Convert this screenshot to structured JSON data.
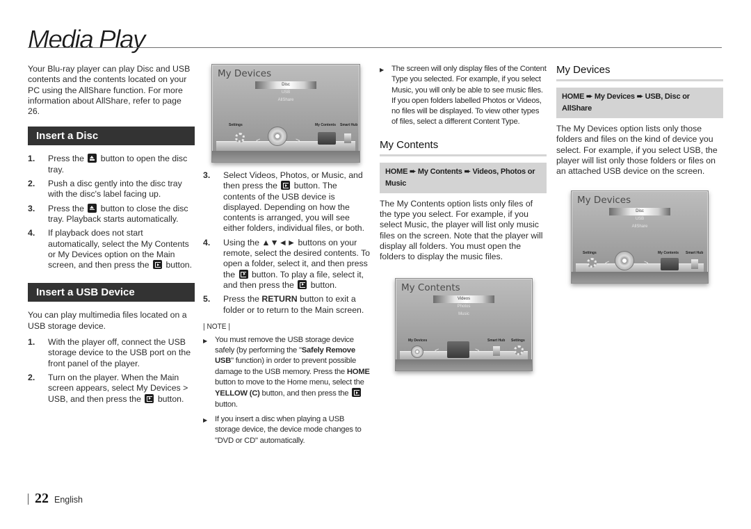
{
  "page": {
    "title": "Media Play",
    "page_number": "22",
    "language": "English"
  },
  "intro": "Your Blu-ray player can play Disc and USB contents and the contents located on your PC using the AllShare function. For more information about AllShare, refer to page 26.",
  "insert_disc": {
    "heading": "Insert a Disc",
    "steps": [
      {
        "num": "1.",
        "before": "Press the",
        "icon": "eject-icon",
        "after": "button to open the disc tray."
      },
      {
        "num": "2.",
        "before": "Push a disc gently into the disc tray with the disc's label facing up.",
        "icon": "",
        "after": ""
      },
      {
        "num": "3.",
        "before": "Press the",
        "icon": "eject-icon",
        "after": "button to close the disc tray. Playback starts automatically."
      },
      {
        "num": "4.",
        "before": "If playback does not start automatically, select the My Contents or My Devices option on the Main screen, and then press the",
        "icon": "enter-icon",
        "after": "button."
      }
    ]
  },
  "insert_usb": {
    "heading": "Insert a USB Device",
    "intro": "You can play multimedia files located on a USB storage device.",
    "steps": [
      {
        "num": "1.",
        "text": "With the player off, connect the USB storage device to the USB port on the front panel of the player."
      },
      {
        "num": "2.",
        "before": "Turn on the player. When the Main screen appears, select My Devices > USB, and then press the",
        "icon": "enter-icon",
        "after": "button."
      },
      {
        "num": "3.",
        "a": "Select Videos, Photos, or Music, and then press the",
        "b": "button. The contents of the USB device is displayed. Depending on how the contents is arranged, you will see either folders, individual files, or both."
      },
      {
        "num": "4.",
        "a": "Using the ▲▼◄► buttons on your remote, select the desired contents. To open a folder, select it, and then press the",
        "b": "button. To play a file, select it, and then press the",
        "c": "button."
      },
      {
        "num": "5.",
        "a": "Press the",
        "bold": "RETURN",
        "b": "button to exit a folder or to return to the Main screen."
      }
    ]
  },
  "note": {
    "heading": "| NOTE |",
    "bullets": [
      {
        "a": "You must remove the USB storage device safely (by performing the \"",
        "b1": "Safely Remove USB",
        "c": "\" function) in order to prevent possible damage to the USB memory. Press the",
        "b2": "HOME",
        "d": "button to move to the Home menu, select the",
        "b3": "YELLOW (C)",
        "e": "button, and then press the",
        "f": "button."
      },
      {
        "a": "If you insert a disc when playing a USB storage device, the device mode changes to \"DVD or CD\" automatically."
      },
      {
        "a": "The screen will only display files of the Content Type you selected. For example, if you select Music, you will only be able to see music files. If you open folders labelled Photos or Videos, no files will be displayed. To view other types of files, select a different Content Type."
      }
    ]
  },
  "my_contents": {
    "heading": "My Contents",
    "path": "HOME ➨ My Contents ➨ Videos, Photos or Music",
    "body": "The My Contents option lists only files of the type you select. For example, if you select Music, the player will list only music files on the screen. Note that the player will display all folders. You must open the folders to display the music files."
  },
  "my_devices": {
    "heading": "My Devices",
    "path": "HOME ➨ My Devices ➨ USB, Disc or AllShare",
    "body": "The My Devices option lists only those folders and files on the kind of device you select. For example, if you select USB, the player will list only those folders or files on an attached USB device on the screen."
  },
  "screens": {
    "devices": {
      "title": "My Devices",
      "menu": [
        "Disc",
        "USB",
        "AllShare"
      ],
      "selected": "Disc",
      "labels": [
        "Settings",
        "My Contents",
        "Smart Hub"
      ]
    },
    "contents": {
      "title": "My Contents",
      "menu": [
        "Videos",
        "Photos",
        "Music"
      ],
      "selected": "Videos",
      "labels": [
        "My Devices",
        "Smart Hub",
        "Settings"
      ]
    }
  }
}
